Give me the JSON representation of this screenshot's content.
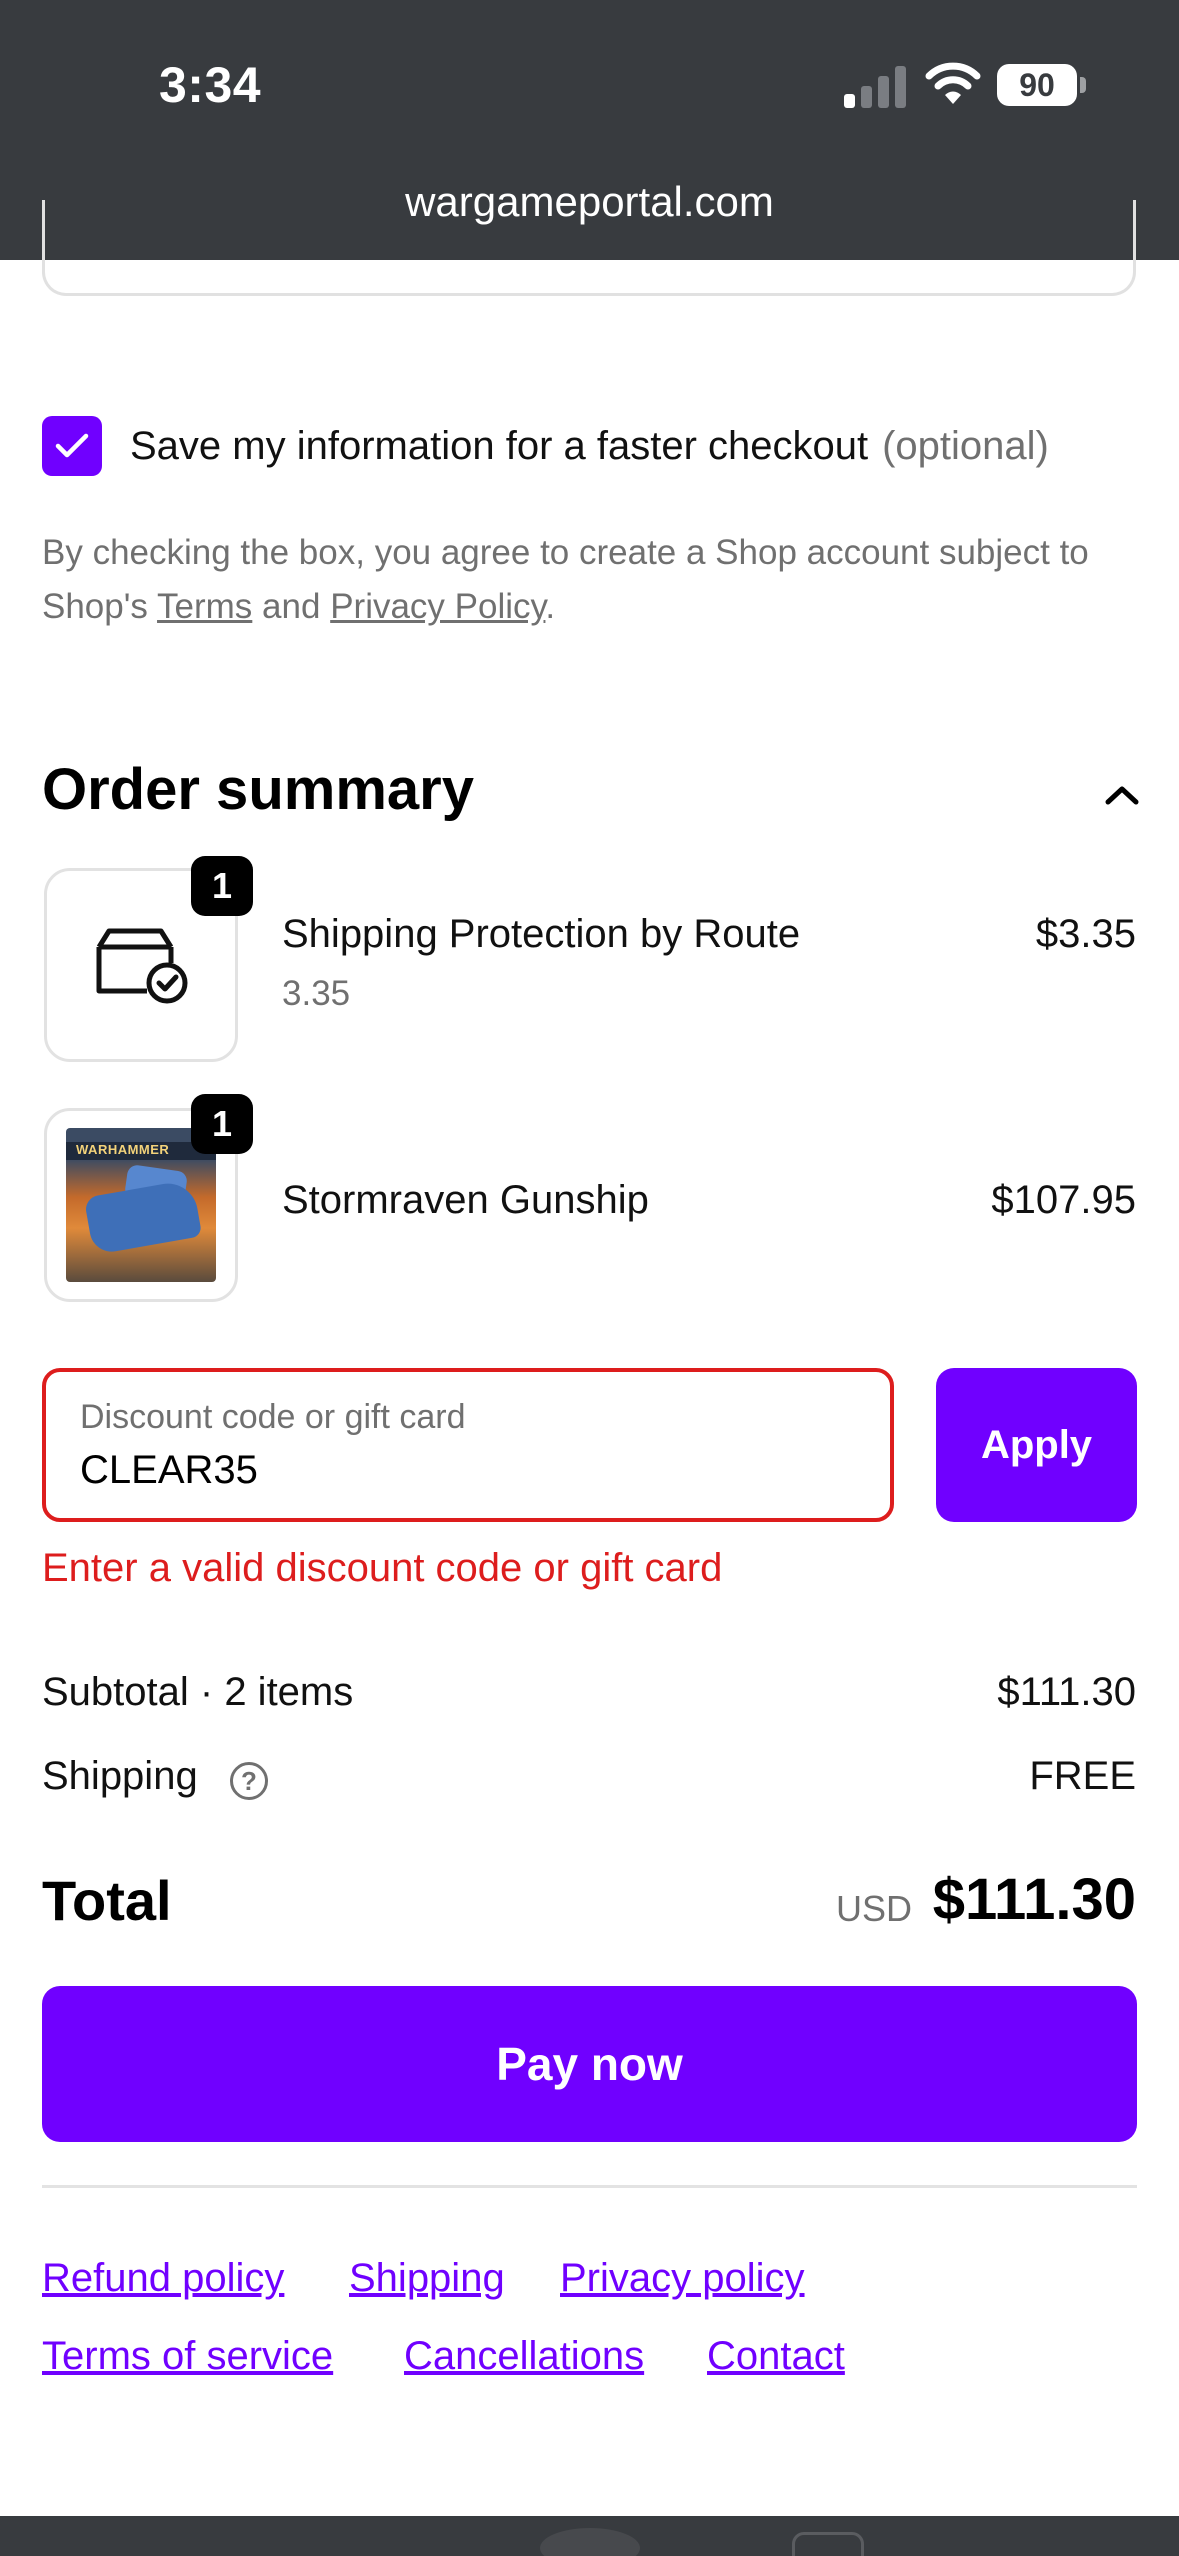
{
  "status_bar": {
    "time": "3:34",
    "battery": "90"
  },
  "browser": {
    "url": "wargameportal.com"
  },
  "save_info": {
    "checked": true,
    "label": "Save my information for a faster checkout",
    "optional": "(optional)",
    "consent_prefix": "By checking the box, you agree to create a Shop account subject to Shop's",
    "terms_link": "Terms",
    "and": "and",
    "privacy_link": "Privacy Policy",
    "period": "."
  },
  "order_summary": {
    "title": "Order summary",
    "items": [
      {
        "quantity": "1",
        "name": "Shipping Protection by Route",
        "variant": "3.35",
        "price": "$3.35",
        "icon": "package-check-icon"
      },
      {
        "quantity": "1",
        "name": "Stormraven Gunship",
        "price": "$107.95",
        "image_text": "WARHAMMER"
      }
    ]
  },
  "discount": {
    "label": "Discount code or gift card",
    "value": "CLEAR35",
    "apply_label": "Apply",
    "error": "Enter a valid discount code or gift card"
  },
  "totals": {
    "subtotal_label": "Subtotal · 2 items",
    "subtotal_value": "$111.30",
    "shipping_label": "Shipping",
    "shipping_help": "?",
    "shipping_value": "FREE",
    "total_label": "Total",
    "currency": "USD",
    "total_value": "$111.30"
  },
  "pay_button": "Pay now",
  "footer_links": [
    "Refund policy",
    "Shipping",
    "Privacy policy",
    "Terms of service",
    "Cancellations",
    "Contact"
  ],
  "colors": {
    "accent": "#7000ff",
    "error": "#dd1d1d",
    "status_bar_bg": "#383b3f"
  }
}
